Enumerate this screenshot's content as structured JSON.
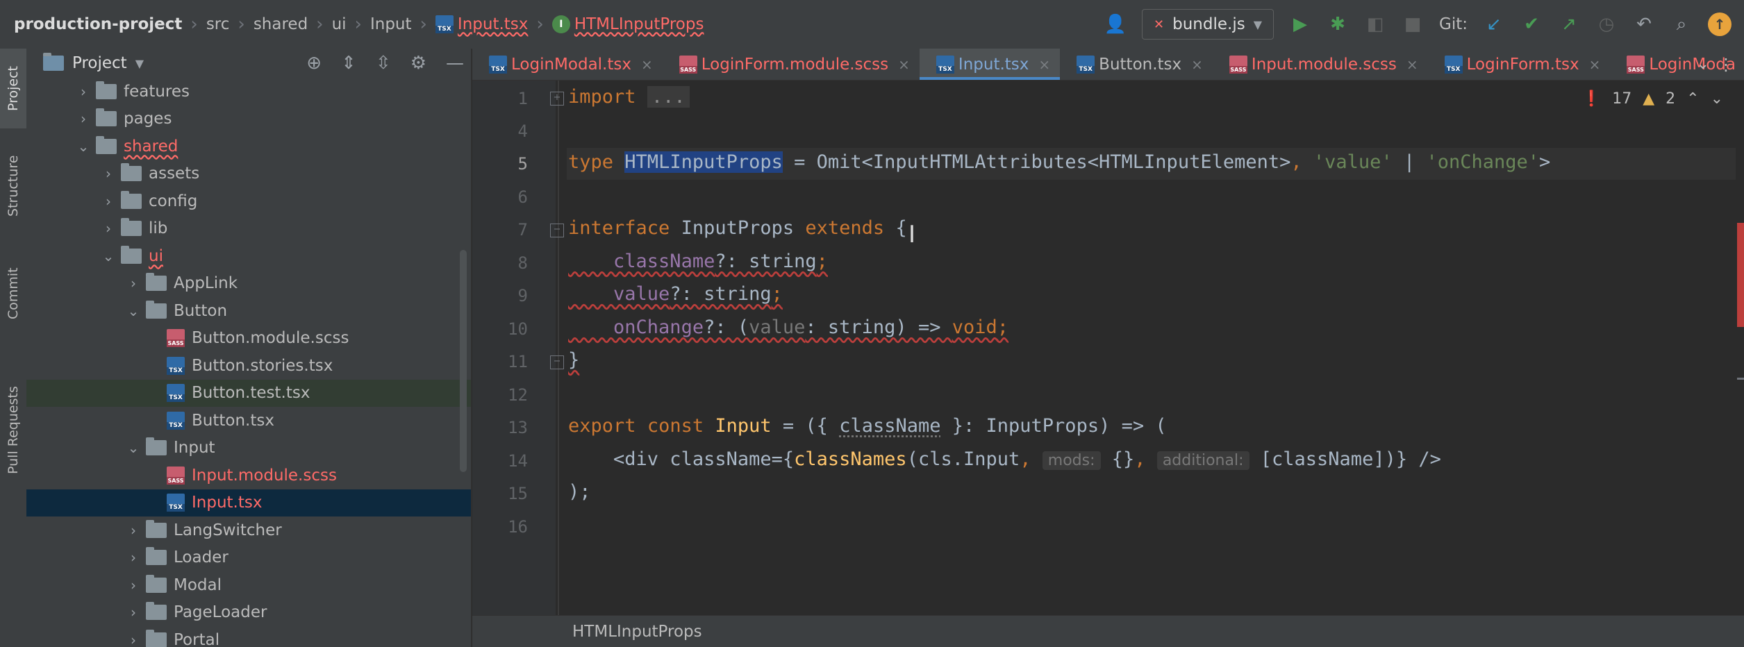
{
  "breadcrumbs": [
    {
      "label": "production-project"
    },
    {
      "label": "src"
    },
    {
      "label": "shared"
    },
    {
      "label": "ui"
    },
    {
      "label": "Input"
    },
    {
      "label": "Input.tsx"
    },
    {
      "label": "HTMLInputProps"
    }
  ],
  "toolbar": {
    "run_config": "bundle.js",
    "git_label": "Git:"
  },
  "side_tabs": [
    "Project",
    "Structure",
    "Commit",
    "Pull Requests"
  ],
  "project_panel": {
    "title": "Project",
    "tree": [
      {
        "label": "features",
        "type": "folder",
        "expanded": false,
        "depth": 1
      },
      {
        "label": "pages",
        "type": "folder",
        "expanded": false,
        "depth": 1
      },
      {
        "label": "shared",
        "type": "folder",
        "expanded": true,
        "depth": 1
      },
      {
        "label": "assets",
        "type": "folder",
        "expanded": false,
        "depth": 2
      },
      {
        "label": "config",
        "type": "folder",
        "expanded": false,
        "depth": 2
      },
      {
        "label": "lib",
        "type": "folder",
        "expanded": false,
        "depth": 2
      },
      {
        "label": "ui",
        "type": "folder",
        "expanded": true,
        "depth": 2
      },
      {
        "label": "AppLink",
        "type": "folder",
        "expanded": false,
        "depth": 3
      },
      {
        "label": "Button",
        "type": "folder",
        "expanded": true,
        "depth": 3
      },
      {
        "label": "Button.module.scss",
        "type": "scss",
        "depth": 4
      },
      {
        "label": "Button.stories.tsx",
        "type": "tsx",
        "depth": 4
      },
      {
        "label": "Button.test.tsx",
        "type": "tsx",
        "depth": 4
      },
      {
        "label": "Button.tsx",
        "type": "tsx",
        "depth": 4
      },
      {
        "label": "Input",
        "type": "folder",
        "expanded": true,
        "depth": 3
      },
      {
        "label": "Input.module.scss",
        "type": "scss",
        "depth": 4
      },
      {
        "label": "Input.tsx",
        "type": "tsx",
        "depth": 4
      },
      {
        "label": "LangSwitcher",
        "type": "folder",
        "expanded": false,
        "depth": 3
      },
      {
        "label": "Loader",
        "type": "folder",
        "expanded": false,
        "depth": 3
      },
      {
        "label": "Modal",
        "type": "folder",
        "expanded": false,
        "depth": 3
      },
      {
        "label": "PageLoader",
        "type": "folder",
        "expanded": false,
        "depth": 3
      },
      {
        "label": "Portal",
        "type": "folder",
        "expanded": false,
        "depth": 3
      }
    ]
  },
  "tabs": [
    {
      "label": "LoginModal.tsx"
    },
    {
      "label": "LoginForm.module.scss"
    },
    {
      "label": "Input.tsx"
    },
    {
      "label": "Button.tsx"
    },
    {
      "label": "Input.module.scss"
    },
    {
      "label": "LoginForm.tsx"
    },
    {
      "label": "LoginModa"
    }
  ],
  "inspections": {
    "errors": "17",
    "warnings": "2"
  },
  "line_numbers": [
    "1",
    "4",
    "5",
    "6",
    "7",
    "8",
    "9",
    "10",
    "11",
    "12",
    "13",
    "14",
    "15",
    "16"
  ],
  "code": {
    "l1_import": "import",
    "l1_fold": "...",
    "l5_type": "type",
    "l5_name": "HTMLInputProps",
    "l5_eq": " = Omit<InputHTMLAttributes<HTMLInputElement>",
    "l5_comma": ",",
    "l5_value": "'value'",
    "l5_pipe": " | ",
    "l5_onchange": "'onChange'",
    "l5_close": ">",
    "l7_interface": "interface",
    "l7_name": " InputProps ",
    "l7_extends": "extends",
    "l7_brace": " {",
    "l8_prop": "className",
    "l8_rest": "?: string",
    "l8_semi": ";",
    "l9_prop": "value",
    "l9_rest": "?: string",
    "l9_semi": ";",
    "l10_prop": "onChange",
    "l10_rest": "?: (",
    "l10_param": "value",
    "l10_rest2": ": string) => ",
    "l10_void": "void",
    "l10_semi": ";",
    "l11": "}",
    "l13_export": "export",
    "l13_const": "const",
    "l13_name": "Input",
    "l13_rest1": " = ({ ",
    "l13_param": "className",
    "l13_rest2": " }: InputProps) => (",
    "l14_open": "<div className={",
    "l14_fn": "classNames",
    "l14_args": "(cls.Input",
    "l14_comma1": ",",
    "l14_hint1": "mods:",
    "l14_obj": "{}",
    "l14_comma2": ",",
    "l14_hint2": "additional:",
    "l14_arr": "[className])} />",
    "l15": ");"
  },
  "status": {
    "breadcrumb": "HTMLInputProps"
  }
}
